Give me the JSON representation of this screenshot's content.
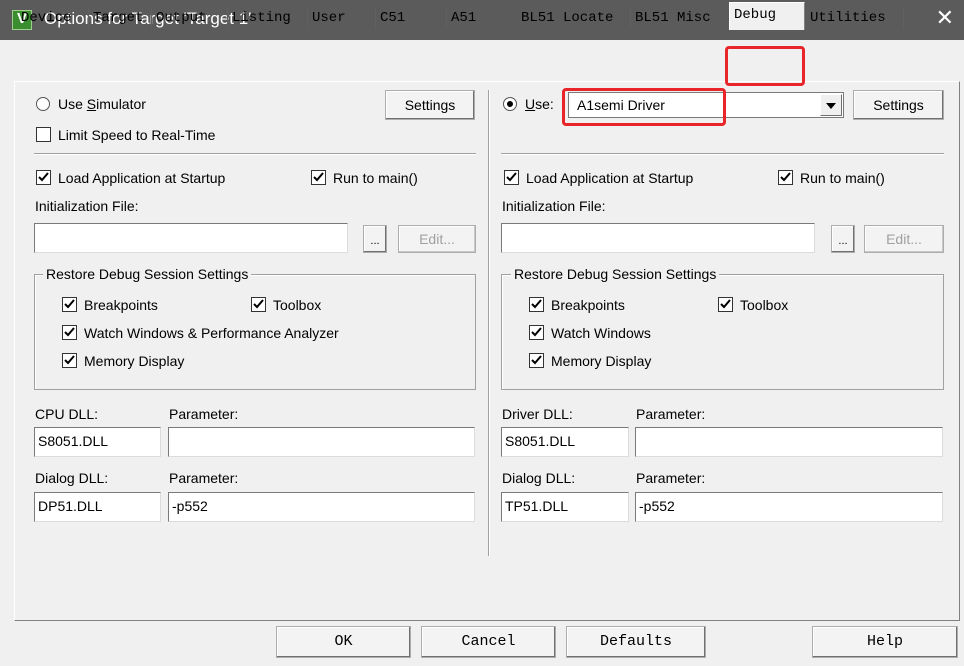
{
  "window": {
    "title": "Options for Target 'Target 1'",
    "close_glyph": "✕"
  },
  "app_icon_letter": "V",
  "tabs": [
    "Device",
    "Target",
    "Output",
    "Listing",
    "User",
    "C51",
    "A51",
    "BL51 Locate",
    "BL51 Misc",
    "Debug",
    "Utilities"
  ],
  "left": {
    "use_simulator": "Use Simulator",
    "use_simulator_mnemonic": "S",
    "use_simulator_pre": "Use ",
    "use_simulator_post": "imulator",
    "settings": "Settings",
    "limit_speed": "Limit Speed to Real-Time",
    "load_app": "Load Application at Startup",
    "run_to_main": "Run to main()",
    "init_file_label": "Initialization File:",
    "init_file_value": "",
    "browse": "...",
    "edit": "Edit...",
    "restore_group": "Restore Debug Session Settings",
    "breakpoints": "Breakpoints",
    "toolbox": "Toolbox",
    "watch_windows": "Watch Windows & Performance Analyzer",
    "memory_display": "Memory Display",
    "cpu_dll_label": "CPU DLL:",
    "cpu_dll_value": "S8051.DLL",
    "cpu_param_label": "Parameter:",
    "cpu_param_value": "",
    "dialog_dll_label": "Dialog DLL:",
    "dialog_dll_value": "DP51.DLL",
    "dialog_param_label": "Parameter:",
    "dialog_param_value": "-p552"
  },
  "right": {
    "use_label": "Use:",
    "use_label_mnemonic": "U",
    "use_label_post": "se:",
    "driver_selected": "A1semi Driver",
    "settings": "Settings",
    "load_app": "Load Application at Startup",
    "run_to_main": "Run to main()",
    "init_file_label": "Initialization File:",
    "init_file_value": "",
    "browse": "...",
    "edit": "Edit...",
    "restore_group": "Restore Debug Session Settings",
    "breakpoints": "Breakpoints",
    "toolbox": "Toolbox",
    "watch_windows": "Watch Windows",
    "memory_display": "Memory Display",
    "driver_dll_label": "Driver DLL:",
    "driver_dll_value": "S8051.DLL",
    "driver_param_label": "Parameter:",
    "driver_param_value": "",
    "dialog_dll_label": "Dialog DLL:",
    "dialog_dll_value": "TP51.DLL",
    "dialog_param_label": "Parameter:",
    "dialog_param_value": "-p552"
  },
  "buttons": {
    "ok": "OK",
    "cancel": "Cancel",
    "defaults": "Defaults",
    "help": "Help"
  },
  "colors": {
    "highlight": "#e8262a",
    "titlebar": "#5b5b5b",
    "dialog": "#f0f0f0"
  }
}
